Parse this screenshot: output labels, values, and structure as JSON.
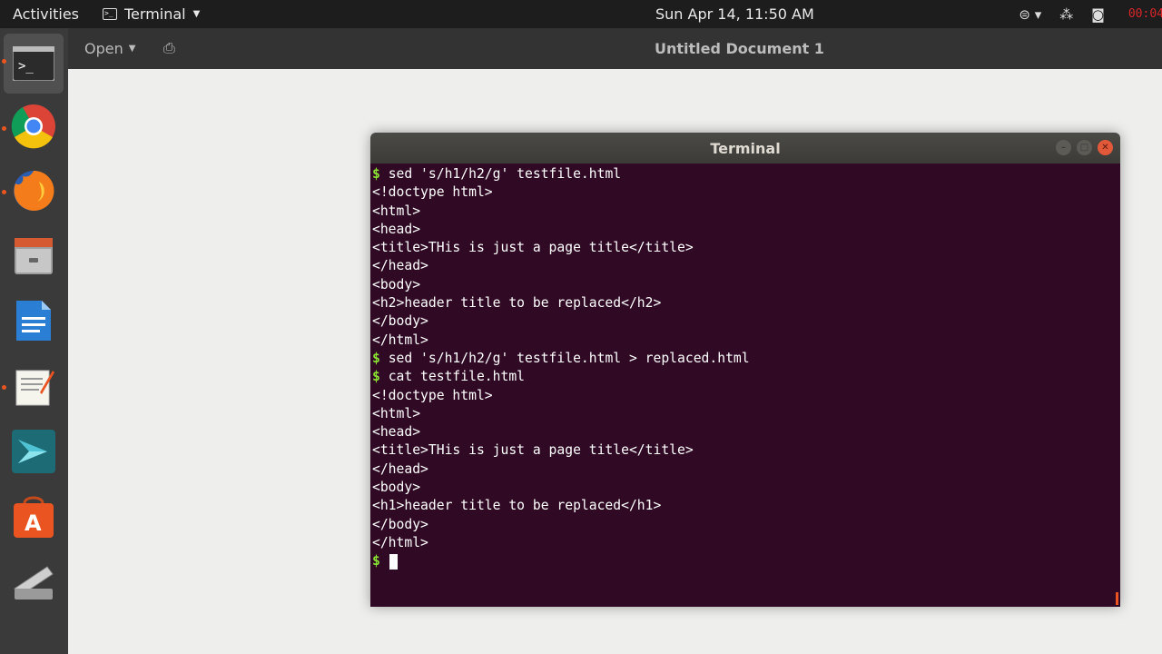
{
  "topbar": {
    "activities": "Activities",
    "app_name": "Terminal",
    "clock": "Sun Apr 14, 11:50 AM",
    "recording": "00:04"
  },
  "gedit": {
    "open_label": "Open",
    "title": "Untitled Document 1"
  },
  "dock": {
    "items": [
      "terminal-icon",
      "chrome-icon",
      "firefox-icon",
      "files-icon",
      "writer-icon",
      "text-editor-icon",
      "netbeans-icon",
      "software-center-icon",
      "scanner-icon"
    ]
  },
  "terminal": {
    "title": "Terminal",
    "lines": [
      {
        "prompt": "$ ",
        "text": "sed 's/h1/h2/g' testfile.html"
      },
      {
        "prompt": "",
        "text": "<!doctype html>"
      },
      {
        "prompt": "",
        "text": "<html>"
      },
      {
        "prompt": "",
        "text": "<head>"
      },
      {
        "prompt": "",
        "text": "<title>THis is just a page title</title>"
      },
      {
        "prompt": "",
        "text": "</head>"
      },
      {
        "prompt": "",
        "text": "<body>"
      },
      {
        "prompt": "",
        "text": "<h2>header title to be replaced</h2>"
      },
      {
        "prompt": "",
        "text": "</body>"
      },
      {
        "prompt": "",
        "text": "</html>"
      },
      {
        "prompt": "$ ",
        "text": "sed 's/h1/h2/g' testfile.html > replaced.html"
      },
      {
        "prompt": "$ ",
        "text": "cat testfile.html"
      },
      {
        "prompt": "",
        "text": "<!doctype html>"
      },
      {
        "prompt": "",
        "text": "<html>"
      },
      {
        "prompt": "",
        "text": "<head>"
      },
      {
        "prompt": "",
        "text": "<title>THis is just a page title</title>"
      },
      {
        "prompt": "",
        "text": "</head>"
      },
      {
        "prompt": "",
        "text": "<body>"
      },
      {
        "prompt": "",
        "text": "<h1>header title to be replaced</h1>"
      },
      {
        "prompt": "",
        "text": "</body>"
      },
      {
        "prompt": "",
        "text": "</html>"
      },
      {
        "prompt": "$ ",
        "text": ""
      }
    ]
  }
}
